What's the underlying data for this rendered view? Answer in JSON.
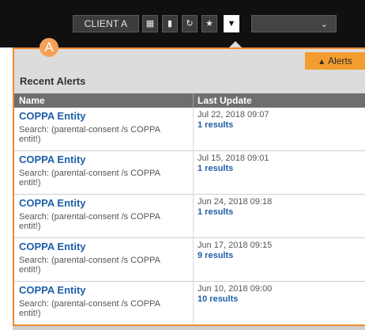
{
  "toolbar": {
    "client_label": "CLIENT A",
    "icons": [
      "calculator-icon",
      "folder-icon",
      "history-icon",
      "star-icon",
      "bell-icon"
    ],
    "select_chevron": "⌄"
  },
  "badge": {
    "label": "A"
  },
  "panel": {
    "alerts_tab_label": "Alerts",
    "section_title": "Recent Alerts",
    "columns": {
      "name": "Name",
      "last_update": "Last Update"
    },
    "rows": [
      {
        "name": "COPPA Entity",
        "search": "Search: (parental-consent /s COPPA entit!)",
        "date": "Jul 22, 2018 09:07",
        "results": "1 results"
      },
      {
        "name": "COPPA Entity",
        "search": "Search: (parental-consent /s COPPA entit!)",
        "date": "Jul 15, 2018 09:01",
        "results": "1 results"
      },
      {
        "name": "COPPA Entity",
        "search": "Search: (parental-consent /s COPPA entit!)",
        "date": "Jun 24, 2018 09:18",
        "results": "1 results"
      },
      {
        "name": "COPPA Entity",
        "search": "Search: (parental-consent /s COPPA entit!)",
        "date": "Jun 17, 2018 09:15",
        "results": "9 results"
      },
      {
        "name": "COPPA Entity",
        "search": "Search: (parental-consent /s COPPA entit!)",
        "date": "Jun 10, 2018 09:00",
        "results": "10 results"
      }
    ]
  },
  "colors": {
    "highlight_border": "#f08a2e",
    "alerts_tab": "#f39c2f",
    "link_blue": "#1f5fa8",
    "topbar": "#101010"
  }
}
